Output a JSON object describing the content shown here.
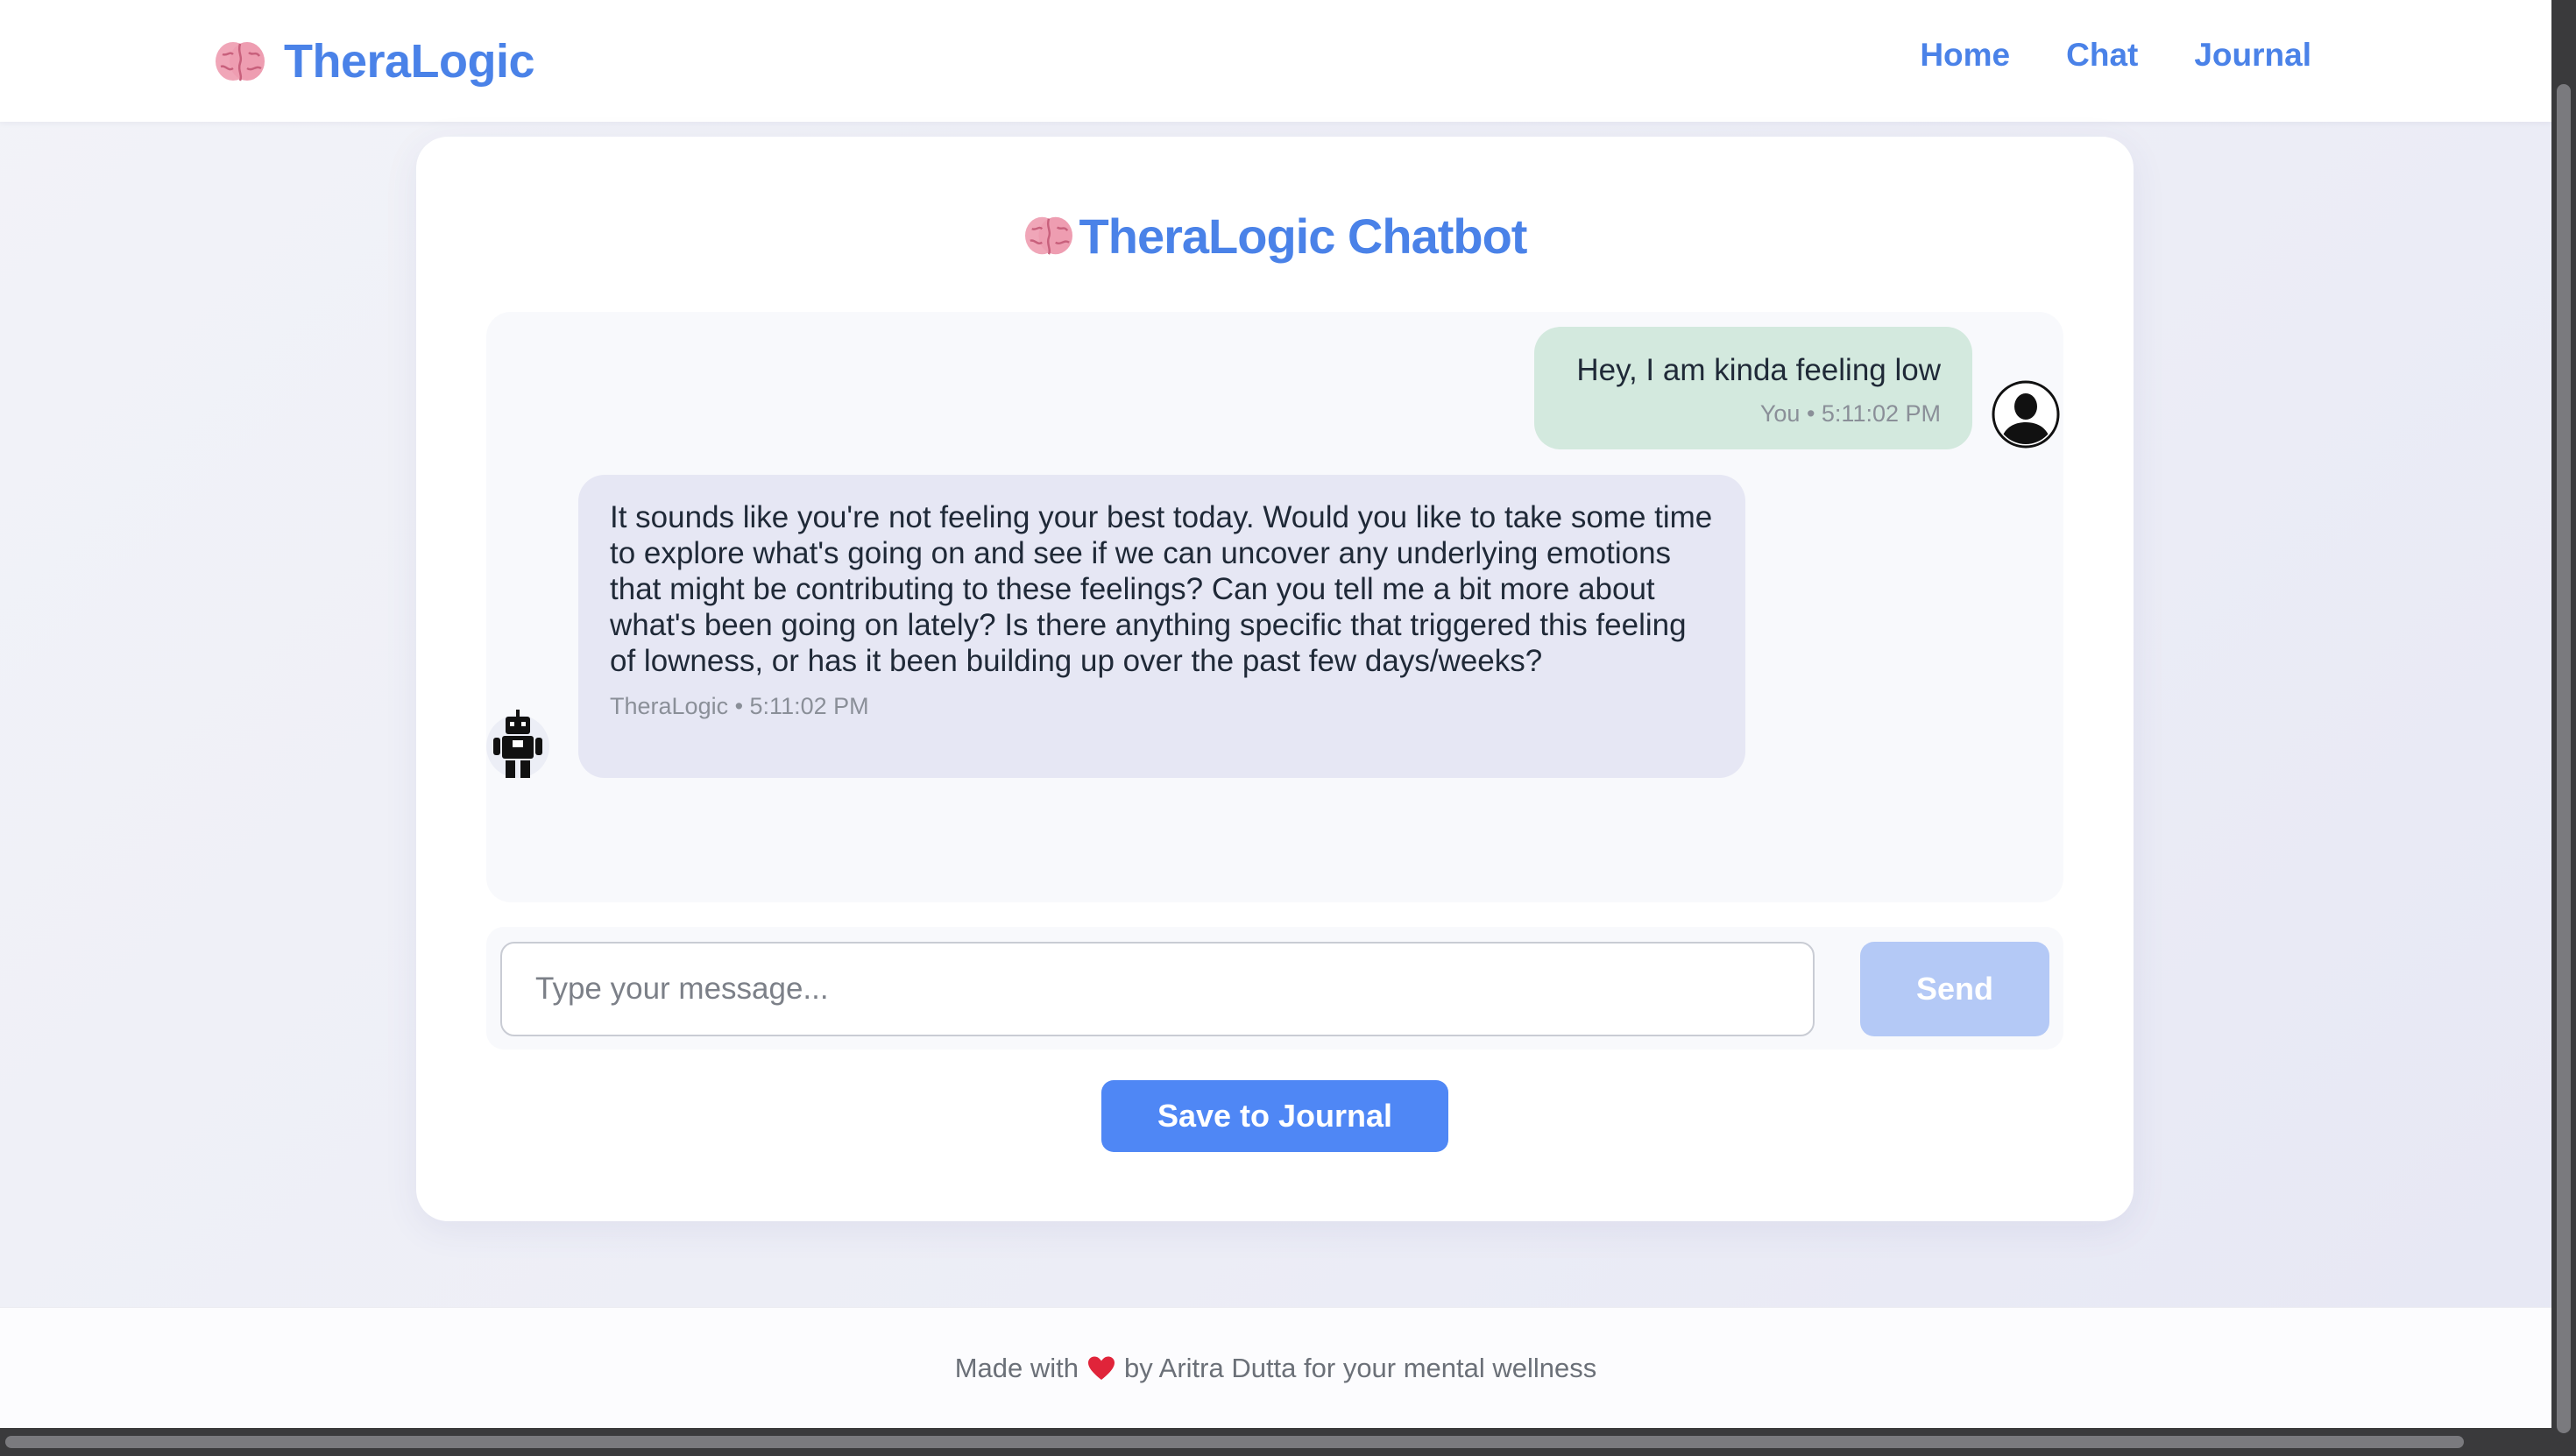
{
  "header": {
    "brand_icon": "brain-icon",
    "brand_name": "TheraLogic",
    "nav": [
      {
        "label": "Home"
      },
      {
        "label": "Chat"
      },
      {
        "label": "Journal"
      }
    ]
  },
  "chat": {
    "title_icon": "brain-icon",
    "title": "TheraLogic Chatbot",
    "messages": [
      {
        "sender": "user",
        "avatar_icon": "user-silhouette-icon",
        "text": "Hey, I am kinda feeling low",
        "meta": "You • 5:11:02 PM"
      },
      {
        "sender": "bot",
        "avatar_icon": "robot-icon",
        "text": "It sounds like you're not feeling your best today. Would you like to take some time to explore what's going on and see if we can uncover any underlying emotions that might be contributing to these feelings? Can you tell me a bit more about what's been going on lately? Is there anything specific that triggered this feeling of lowness, or has it been building up over the past few days/weeks?",
        "meta": "TheraLogic • 5:11:02 PM"
      }
    ],
    "input": {
      "value": "",
      "placeholder": "Type your message..."
    },
    "send_label": "Send",
    "save_label": "Save to Journal"
  },
  "footer": {
    "prefix": "Made with",
    "heart_icon": "heart-icon",
    "suffix": "by Aritra Dutta for your mental wellness"
  },
  "colors": {
    "accent": "#4a82e8",
    "user_bubble": "#d3e9de",
    "bot_bubble": "#e6e7f4",
    "send_disabled": "#b4c9f6",
    "save_button": "#4f87f5"
  }
}
